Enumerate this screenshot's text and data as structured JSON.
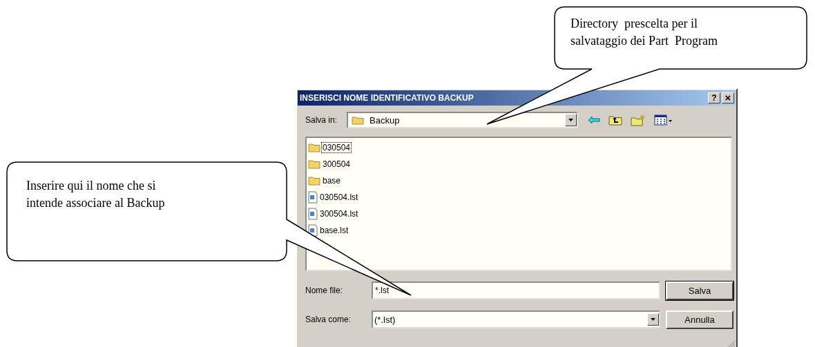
{
  "window": {
    "title": "INSERISCI NOME IDENTIFICATIVO BACKUP",
    "title_buttons": [
      {
        "kind": "help",
        "label": "?"
      },
      {
        "kind": "close",
        "label": "×"
      }
    ]
  },
  "location": {
    "label": "Salva in:",
    "value": "Backup"
  },
  "files": [
    {
      "kind": "folder",
      "name": "030504",
      "selected": true
    },
    {
      "kind": "folder",
      "name": "300504",
      "selected": false
    },
    {
      "kind": "folder",
      "name": "base",
      "selected": false
    },
    {
      "kind": "file",
      "name": "030504.lst",
      "selected": false
    },
    {
      "kind": "file",
      "name": "300504.lst",
      "selected": false
    },
    {
      "kind": "file",
      "name": "base.lst",
      "selected": false
    }
  ],
  "filename": {
    "label": "Nome file:",
    "value": "*.lst"
  },
  "filetype": {
    "label": "Salva come:",
    "value": "(*.lst)"
  },
  "buttons": [
    "Salva",
    "Annulla"
  ],
  "callouts": [
    {
      "lines": [
        "Directory  prescelta per il",
        "salvataggio dei Part  Program"
      ]
    },
    {
      "lines": [
        "Inserire qui il nome che si",
        "intende associare al Backup"
      ]
    }
  ]
}
